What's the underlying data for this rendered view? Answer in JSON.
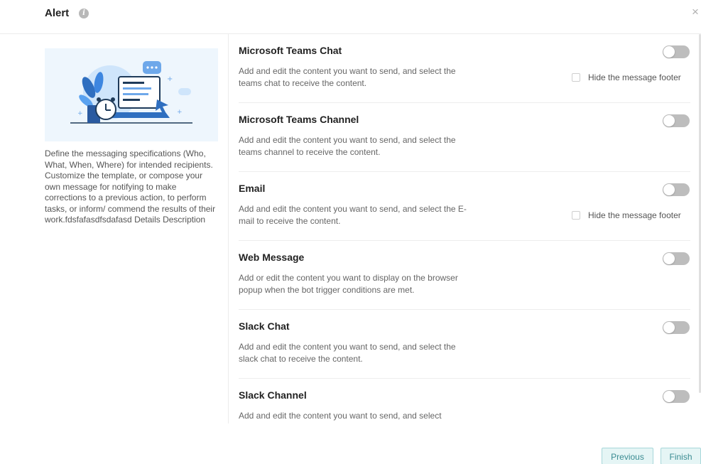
{
  "dialog": {
    "title": "Alert",
    "close_symbol": "×",
    "info_symbol": "i"
  },
  "left": {
    "illustration": "alert-illustration",
    "description": "Define the messaging specifications (Who, What, When, Where) for intended recipients. Customize the template, or compose your own message for notifying to make corrections to a previous action, to perform tasks, or inform/ commend the results of their work.fdsfafasdfsdafasd Details Description"
  },
  "channels": [
    {
      "name": "Microsoft Teams Chat",
      "description": "Add and edit the content you want to send, and select the teams chat to receive the content.",
      "enabled": false,
      "footer_option": "Hide the message footer"
    },
    {
      "name": "Microsoft Teams Channel",
      "description": "Add and edit the content you want to send, and select the teams channel to receive the content.",
      "enabled": false
    },
    {
      "name": "Email",
      "description": "Add and edit the content you want to send, and select the E-mail to receive the content.",
      "enabled": false,
      "footer_option": "Hide the message footer"
    },
    {
      "name": "Web Message",
      "description": "Add or edit the content you want to display on the browser popup when the bot trigger conditions are met.",
      "enabled": false
    },
    {
      "name": "Slack Chat",
      "description": "Add and edit the content you want to send, and select the slack chat to receive the content.",
      "enabled": false
    },
    {
      "name": "Slack Channel",
      "description": "Add and edit the content you want to send, and select",
      "enabled": false
    }
  ],
  "buttons": {
    "previous": "Previous",
    "finish": "Finish"
  },
  "colors": {
    "accent": "#3b8c92",
    "button_bg": "#e5f5f5",
    "toggle_off": "#bdbdbd",
    "illustration_bg": "#eef6fd"
  }
}
